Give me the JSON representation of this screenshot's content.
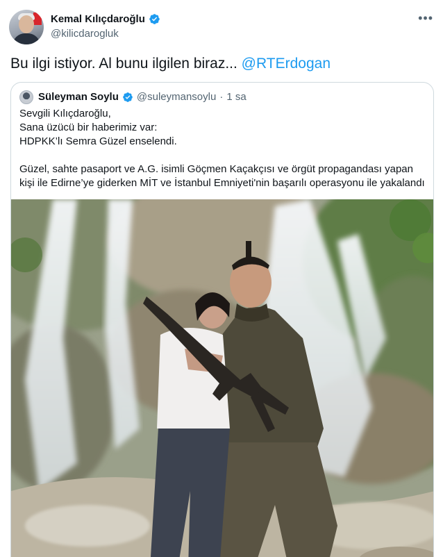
{
  "author": {
    "display_name": "Kemal Kılıçdaroğlu",
    "handle": "@kilicdarogluk",
    "avatar_icon": "profile-photo-icon",
    "verified_icon": "verified-badge-icon"
  },
  "tweet": {
    "text": "Bu ilgi istiyor. Al bunu ilgilen biraz... ",
    "mention": "@RTErdogan",
    "more_icon": "more-options-icon"
  },
  "quoted": {
    "display_name": "Süleyman Soylu",
    "handle": "@suleymansoylu",
    "separator": "·",
    "time": "1 sa",
    "lines": [
      "Sevgili Kılıçdaroğlu,",
      "Sana üzücü bir haberimiz var:",
      "HDPKK’lı Semra Güzel enselendi.",
      "",
      "Güzel, sahte pasaport ve A.G. isimli Göçmen Kaçakçısı ve örgüt propagandası yapan",
      "kişi ile Edirne’ye giderken MİT ve İstanbul Emniyeti'nin başarılı operasyonu ile yakalandı"
    ],
    "photo_icon": "attached-photo-icon"
  },
  "colors": {
    "accent": "#1d9bf0",
    "text": "#0f1419",
    "secondary": "#536471",
    "border": "#cfd9de"
  }
}
